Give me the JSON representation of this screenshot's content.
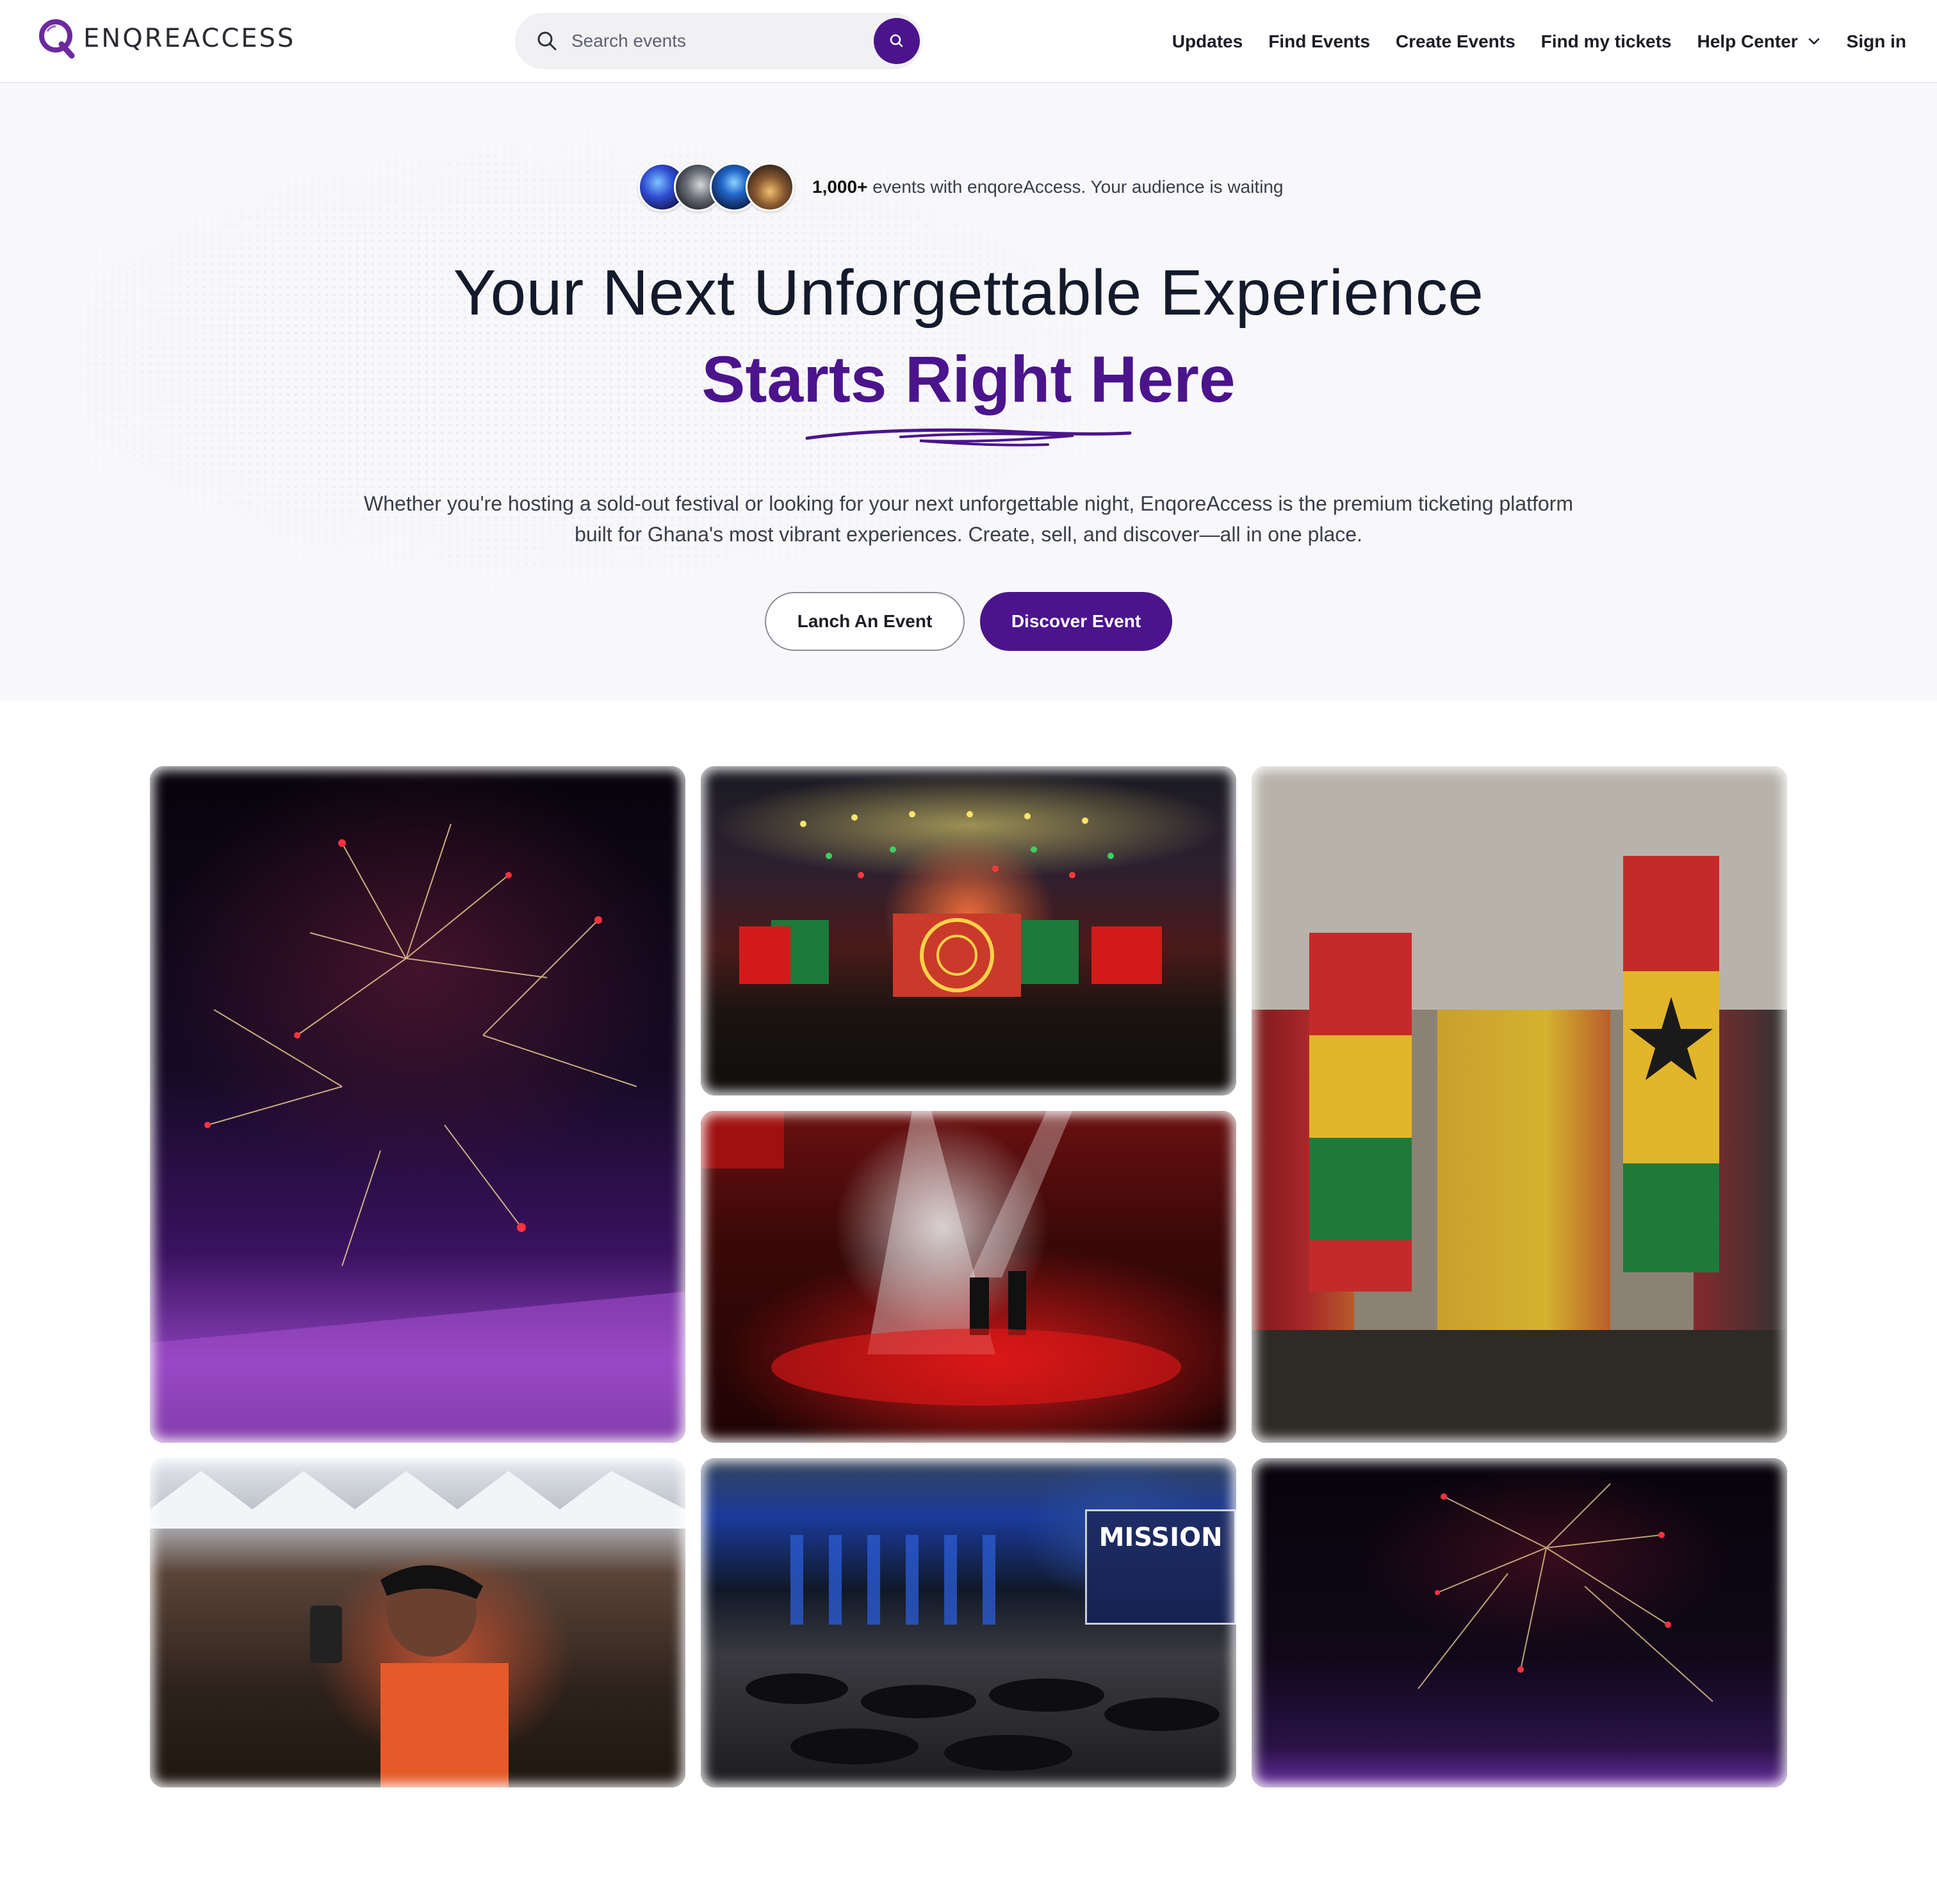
{
  "brand": {
    "name": "ENQREACCESS",
    "primary_color": "#4b148c"
  },
  "search": {
    "placeholder": "Search events",
    "icon": "search-icon",
    "button_icon": "search-icon"
  },
  "nav": {
    "items": [
      {
        "label": "Updates"
      },
      {
        "label": "Find Events"
      },
      {
        "label": "Create Events"
      },
      {
        "label": "Find my tickets"
      },
      {
        "label": "Help Center",
        "icon": "chevron-down-icon"
      },
      {
        "label": "Sign in"
      }
    ]
  },
  "hero": {
    "social_proof": {
      "count": "1,000+",
      "text": " events with enqoreAccess. Your audience is waiting"
    },
    "title_line1": "Your Next Unforgettable Experience",
    "title_line2": "Starts Right Here",
    "description": "Whether you're hosting a sold-out festival or looking for your next unforgettable night, EnqoreAccess is the premium ticketing platform built for Ghana's most vibrant experiences. Create, sell, and discover—all in one place.",
    "buttons": {
      "secondary": "Lanch An Event",
      "primary": "Discover Event"
    }
  },
  "gallery": {
    "images": [
      {
        "subject": "fireworks-over-stage"
      },
      {
        "subject": "concert-stage-lights"
      },
      {
        "subject": "independence-arch-event"
      },
      {
        "subject": "awards-gala-spotlight"
      },
      {
        "subject": "festival-crowd-selfie"
      },
      {
        "subject": "conference-banquet-hall"
      },
      {
        "subject": "night-fireworks"
      }
    ],
    "mission_screen": "MISSION"
  }
}
